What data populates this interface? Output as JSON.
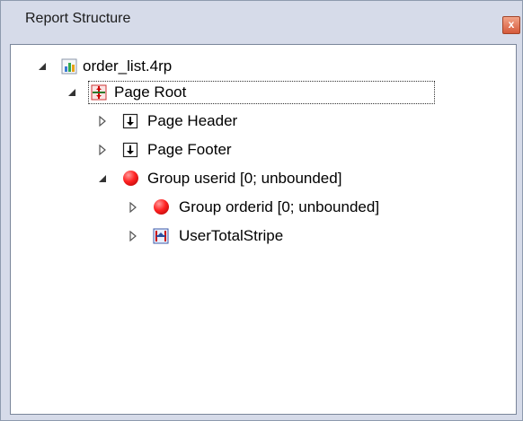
{
  "window": {
    "title": "Report Structure",
    "close_glyph": "x"
  },
  "tree": {
    "items": [
      {
        "label": "order_list.4rp",
        "icon": "report-file-icon",
        "expanded": true
      },
      {
        "label": "Page Root",
        "icon": "page-root-icon",
        "expanded": true,
        "selected": true
      },
      {
        "label": "Page Header",
        "icon": "stripe-arrow-icon",
        "expanded": false
      },
      {
        "label": "Page Footer",
        "icon": "stripe-arrow-icon",
        "expanded": false
      },
      {
        "label": "Group userid [0; unbounded]",
        "icon": "group-ball-icon",
        "expanded": true
      },
      {
        "label": "Group orderid [0; unbounded]",
        "icon": "group-ball-icon",
        "expanded": false
      },
      {
        "label": "UserTotalStripe",
        "icon": "stripe-icon",
        "expanded": false
      }
    ]
  },
  "colors": {
    "frame": "#d6dbe9",
    "close": "#d55a3b",
    "group_ball": "#ff2222"
  }
}
